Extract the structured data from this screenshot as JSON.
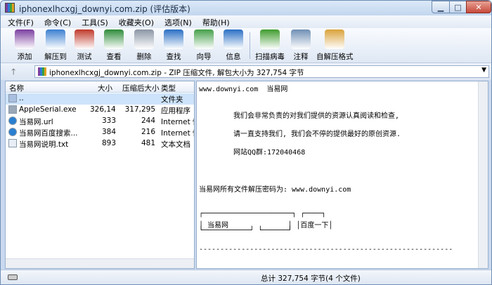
{
  "window": {
    "title": "iphonexlhcxgj_downyi.com.zip (评估版本)"
  },
  "menu": [
    "文件(F)",
    "命令(C)",
    "工具(S)",
    "收藏夹(O)",
    "选项(N)",
    "帮助(H)"
  ],
  "toolbar": [
    {
      "label": "添加",
      "icon": "add-icon",
      "color": "#7b3fa0"
    },
    {
      "label": "解压到",
      "icon": "extract-folder-icon",
      "color": "#3b7fd0"
    },
    {
      "label": "测试",
      "icon": "test-icon",
      "color": "#c0392b"
    },
    {
      "label": "查看",
      "icon": "view-book-icon",
      "color": "#2e8b3a"
    },
    {
      "label": "删除",
      "icon": "delete-trash-icon",
      "color": "#8a95a5"
    },
    {
      "label": "查找",
      "icon": "find-magnifier-icon",
      "color": "#2a6fc4"
    },
    {
      "label": "向导",
      "icon": "wizard-icon",
      "color": "#45a04a"
    },
    {
      "label": "信息",
      "icon": "info-icon",
      "color": "#2a6fc4"
    },
    {
      "label": "扫描病毒",
      "icon": "virus-scan-icon",
      "color": "#3f9c2e"
    },
    {
      "label": "注释",
      "icon": "comment-icon",
      "color": "#6f8fb5"
    },
    {
      "label": "自解压格式",
      "icon": "sfx-icon",
      "color": "#d9a23a"
    }
  ],
  "address": {
    "text": "iphonexlhcxgj_downyi.com.zip - ZIP 压缩文件, 解包大小为 327,754 字节"
  },
  "filelist": {
    "headers": [
      "名称",
      "大小",
      "压缩后大小",
      "类型"
    ],
    "rows": [
      {
        "name": "..",
        "size": "",
        "packed": "",
        "type": "文件夹",
        "icon": "parent-folder-icon",
        "selected": true
      },
      {
        "name": "AppleSerial.exe",
        "size": "326,144",
        "packed": "317,295",
        "type": "应用程序",
        "icon": "exe-icon",
        "selected": false
      },
      {
        "name": "当易网.url",
        "size": "333",
        "packed": "244",
        "type": "Internet 快",
        "icon": "url-globe-icon",
        "selected": false
      },
      {
        "name": "当易网百度搜索...",
        "size": "384",
        "packed": "216",
        "type": "Internet 快",
        "icon": "url-globe-icon",
        "selected": false
      },
      {
        "name": "当易网说明.txt",
        "size": "893",
        "packed": "481",
        "type": "文本文档",
        "icon": "text-file-icon",
        "selected": false
      }
    ]
  },
  "preview": {
    "lines": [
      "www.downyi.com  当易网",
      "我们会非常负责的对我们提供的资源认真阅读和检查,",
      "请一直支持我们, 我们会不停的提供最好的原创资源.",
      "网站QQ群:172040468",
      "当易网所有文件解压密码为: www.downyi.com",
      "┌─────────────────────┐ ┌────┐",
      "│ 当易网              │ │百度一下│",
      "└───────────┘ └──────┘",
      "------------------------------------------------------------"
    ]
  },
  "status": {
    "text": "总计 327,754 字节(4 个文件)"
  }
}
